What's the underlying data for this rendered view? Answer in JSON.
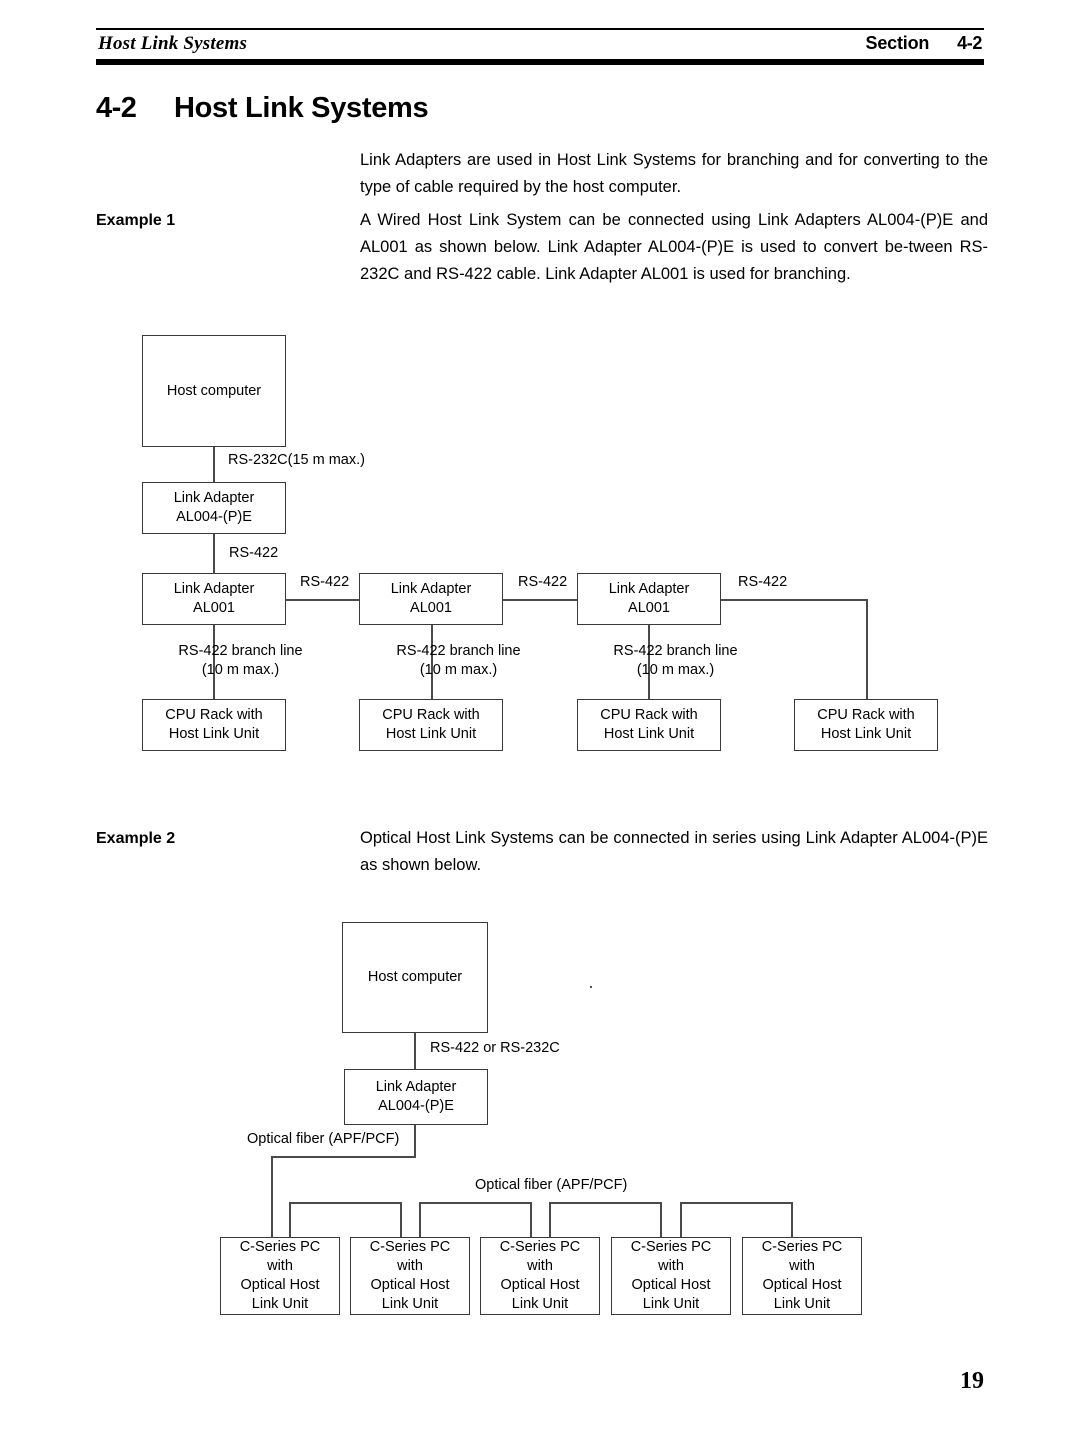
{
  "header": {
    "left_title": "Host Link Systems",
    "section_label": "Section",
    "section_number": "4-2"
  },
  "section": {
    "number": "4-2",
    "title": "Host Link Systems"
  },
  "intro": {
    "text": "Link Adapters are used in Host Link Systems for branching and for converting to the type of cable required by the host computer."
  },
  "example1": {
    "label": "Example 1",
    "text": "A Wired Host Link System can be connected using Link Adapters AL004-(P)E and AL001 as shown below. Link Adapter AL004-(P)E is used to convert be-tween RS-232C and RS-422 cable. Link Adapter AL001 is used for branching."
  },
  "example2": {
    "label": "Example 2",
    "text": "Optical Host Link Systems can be connected in series using Link Adapter AL004-(P)E as shown below."
  },
  "diagram1": {
    "host_computer": "Host computer",
    "link_adapter_al004": "Link Adapter\nAL004-(P)E",
    "link_adapter_al004_line1": "Link Adapter",
    "link_adapter_al004_line2": "AL004-(P)E",
    "link_adapter_al001_line1": "Link Adapter",
    "link_adapter_al001_line2": "AL001",
    "cpu_rack_line1": "CPU Rack with",
    "cpu_rack_line2": "Host Link Unit",
    "cable_rs232c": "RS-232C(15 m max.)",
    "cable_rs422": "RS-422",
    "branch_line1": "RS-422 branch line",
    "branch_line2": "(10 m max.)",
    "al001_boxes": [
      "AL001",
      "AL001",
      "AL001"
    ],
    "rs422_links": [
      "RS-422",
      "RS-422",
      "RS-422"
    ],
    "racks": [
      "CPU Rack with Host Link Unit",
      "CPU Rack with Host Link Unit",
      "CPU Rack with Host Link Unit",
      "CPU Rack with Host Link Unit"
    ]
  },
  "diagram2": {
    "host_computer": "Host computer",
    "cable_rs422_or_rs232c": "RS-422 or RS-232C",
    "link_adapter_line1": "Link Adapter",
    "link_adapter_line2": "AL004-(P)E",
    "optical_fiber_left": "Optical fiber (APF/PCF)",
    "optical_fiber_right": "Optical fiber (APF/PCF)",
    "pc_line1": "C-Series PC",
    "pc_line2": "with",
    "pc_line3": "Optical Host",
    "pc_line4": "Link Unit",
    "pc_boxes": [
      "C-Series PC with Optical Host Link Unit",
      "C-Series PC with Optical Host Link Unit",
      "C-Series PC with Optical Host Link Unit",
      "C-Series PC with Optical Host Link Unit",
      "C-Series PC with Optical Host Link Unit"
    ]
  },
  "footer": {
    "page_number": "19"
  }
}
